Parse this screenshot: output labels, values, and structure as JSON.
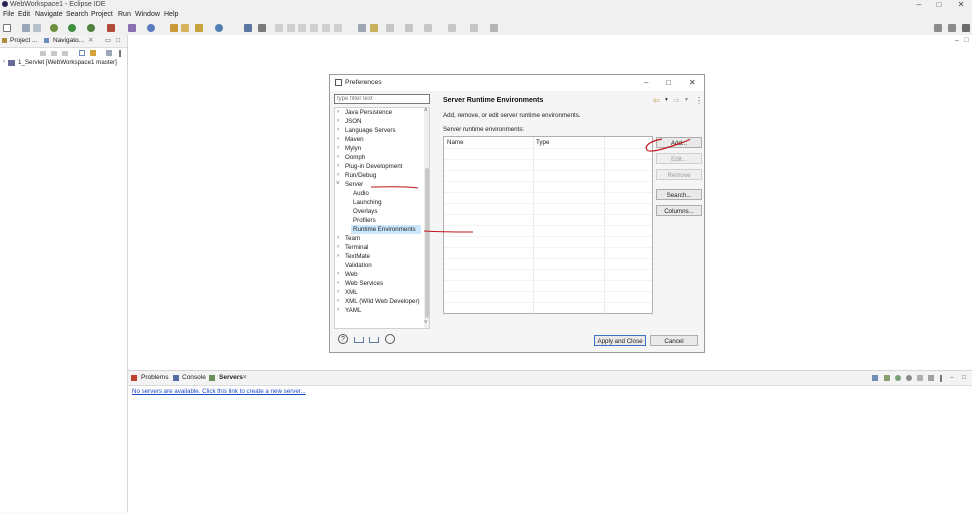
{
  "window": {
    "title": "WebWorkspace1 - Eclipse IDE"
  },
  "menu": [
    "File",
    "Edit",
    "Navigate",
    "Search",
    "Project",
    "Run",
    "Window",
    "Help"
  ],
  "left_panel": {
    "tabs": [
      "Project ...",
      "Navigato..."
    ],
    "tree_item": "1_Servlet [WebWorkspace1 master]"
  },
  "dialog": {
    "title": "Preferences",
    "filter_placeholder": "type filter text",
    "tree": [
      {
        "label": "Java Persistence",
        "level": 0,
        "arrow": "collapsed"
      },
      {
        "label": "JSON",
        "level": 0,
        "arrow": "collapsed"
      },
      {
        "label": "Language Servers",
        "level": 0,
        "arrow": "collapsed"
      },
      {
        "label": "Maven",
        "level": 0,
        "arrow": "collapsed"
      },
      {
        "label": "Mylyn",
        "level": 0,
        "arrow": "collapsed"
      },
      {
        "label": "Oomph",
        "level": 0,
        "arrow": "collapsed"
      },
      {
        "label": "Plug-in Development",
        "level": 0,
        "arrow": "collapsed"
      },
      {
        "label": "Run/Debug",
        "level": 0,
        "arrow": "collapsed"
      },
      {
        "label": "Server",
        "level": 0,
        "arrow": "expanded"
      },
      {
        "label": "Audio",
        "level": 1,
        "arrow": "none"
      },
      {
        "label": "Launching",
        "level": 1,
        "arrow": "none"
      },
      {
        "label": "Overlays",
        "level": 1,
        "arrow": "none"
      },
      {
        "label": "Profilers",
        "level": 1,
        "arrow": "none"
      },
      {
        "label": "Runtime Environments",
        "level": 1,
        "arrow": "none",
        "selected": true
      },
      {
        "label": "Team",
        "level": 0,
        "arrow": "collapsed"
      },
      {
        "label": "Terminal",
        "level": 0,
        "arrow": "collapsed"
      },
      {
        "label": "TextMate",
        "level": 0,
        "arrow": "collapsed"
      },
      {
        "label": "Validation",
        "level": 0,
        "arrow": "none"
      },
      {
        "label": "Web",
        "level": 0,
        "arrow": "collapsed"
      },
      {
        "label": "Web Services",
        "level": 0,
        "arrow": "collapsed"
      },
      {
        "label": "XML",
        "level": 0,
        "arrow": "collapsed"
      },
      {
        "label": "XML (Wild Web Developer)",
        "level": 0,
        "arrow": "collapsed"
      },
      {
        "label": "YAML",
        "level": 0,
        "arrow": "collapsed"
      }
    ],
    "page": {
      "title": "Server Runtime Environments",
      "description": "Add, remove, or edit server runtime environments.",
      "table_label": "Server runtime environments:",
      "columns": [
        "Name",
        "Type"
      ],
      "buttons": {
        "add": "Add...",
        "edit": "Edit...",
        "remove": "Remove",
        "search": "Search...",
        "columns": "Columns..."
      }
    },
    "footer": {
      "apply_close": "Apply and Close",
      "cancel": "Cancel"
    }
  },
  "bottom_panel": {
    "tabs": [
      "Problems",
      "Console",
      "Servers"
    ],
    "servers_link": "No servers are available. Click this link to create a new server..."
  },
  "colors": {
    "annotation": "#c0141c",
    "selection": "#cce8ff",
    "link": "#1a46c8"
  }
}
